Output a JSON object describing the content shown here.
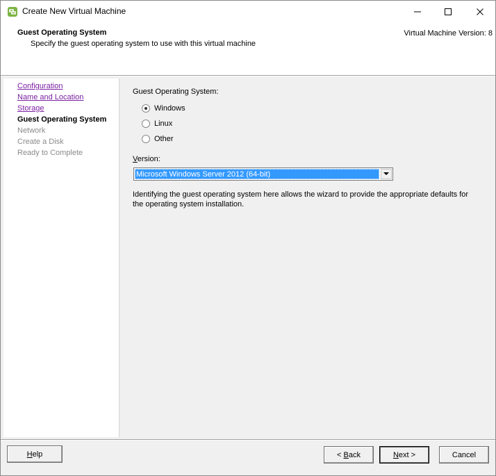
{
  "window": {
    "title": "Create New Virtual Machine",
    "controls": {
      "minimize": "minimize",
      "maximize": "maximize",
      "close": "close"
    }
  },
  "header": {
    "title": "Guest Operating System",
    "subtitle": "Specify the guest operating system to use with this virtual machine",
    "version": "Virtual Machine Version: 8"
  },
  "steps": [
    {
      "label": "Configuration",
      "state": "done"
    },
    {
      "label": "Name and Location",
      "state": "done"
    },
    {
      "label": "Storage",
      "state": "done"
    },
    {
      "label": "Guest Operating System",
      "state": "current"
    },
    {
      "label": "Network",
      "state": "pending"
    },
    {
      "label": "Create a Disk",
      "state": "pending"
    },
    {
      "label": "Ready to Complete",
      "state": "pending"
    }
  ],
  "form": {
    "os_label": "Guest Operating System:",
    "os_options": [
      {
        "label": "Windows",
        "checked": true
      },
      {
        "label": "Linux",
        "checked": false
      },
      {
        "label": "Other",
        "checked": false
      }
    ],
    "version_label": "Version:",
    "version_value": "Microsoft Windows Server 2012 (64-bit)",
    "help_text": "Identifying the guest operating system here allows the wizard to provide the appropriate defaults for the operating system installation."
  },
  "footer": {
    "help": "Help",
    "back": "< Back",
    "next": "Next >",
    "cancel": "Cancel"
  },
  "colors": {
    "link": "#7a1fa2",
    "selection": "#3399ff",
    "panel": "#f0f0f0"
  }
}
